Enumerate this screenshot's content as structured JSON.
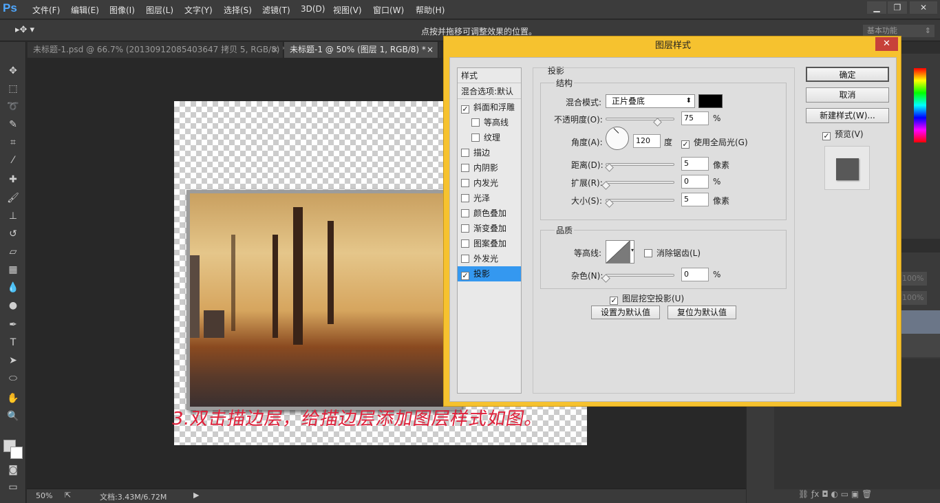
{
  "app": {
    "logo": "Ps"
  },
  "menu": [
    "文件(F)",
    "编辑(E)",
    "图像(I)",
    "图层(L)",
    "文字(Y)",
    "选择(S)",
    "滤镜(T)",
    "3D(D)",
    "视图(V)",
    "窗口(W)",
    "帮助(H)"
  ],
  "options_bar": {
    "hint": "点按并拖移可调整效果的位置。",
    "workspace": "基本功能"
  },
  "tabs": [
    {
      "label": "未标题-1.psd @ 66.7% (20130912085403647 拷贝 5, RGB/8) *"
    },
    {
      "label": "未标题-1 @ 50% (图层 1, RGB/8) *"
    }
  ],
  "caption": "3.双击描边层，给描边层添加图层样式如图。",
  "status": {
    "zoom": "50%",
    "doc": "文档:3.43M/6.72M"
  },
  "right_panel": {
    "opacity1": "100%",
    "opacity2": "100%"
  },
  "dialog": {
    "title": "图层样式",
    "styles_header": "样式",
    "blend_options": "混合选项:默认",
    "items": [
      {
        "label": "斜面和浮雕",
        "checked": "✓"
      },
      {
        "label": "等高线",
        "checked": ""
      },
      {
        "label": "纹理",
        "checked": ""
      },
      {
        "label": "描边",
        "checked": ""
      },
      {
        "label": "内阴影",
        "checked": ""
      },
      {
        "label": "内发光",
        "checked": ""
      },
      {
        "label": "光泽",
        "checked": ""
      },
      {
        "label": "颜色叠加",
        "checked": ""
      },
      {
        "label": "渐变叠加",
        "checked": ""
      },
      {
        "label": "图案叠加",
        "checked": ""
      },
      {
        "label": "外发光",
        "checked": ""
      },
      {
        "label": "投影",
        "checked": "✓"
      }
    ],
    "section_title": "投影",
    "structure": {
      "title": "结构",
      "blend_mode_label": "混合模式:",
      "blend_mode_value": "正片叠底",
      "shadow_color": "#000000",
      "opacity_label": "不透明度(O):",
      "opacity_value": "75",
      "opacity_unit": "%",
      "angle_label": "角度(A):",
      "angle_value": "120",
      "angle_unit": "度",
      "global_light_label": "使用全局光(G)",
      "distance_label": "距离(D):",
      "distance_value": "5",
      "distance_unit": "像素",
      "spread_label": "扩展(R):",
      "spread_value": "0",
      "spread_unit": "%",
      "size_label": "大小(S):",
      "size_value": "5",
      "size_unit": "像素"
    },
    "quality": {
      "title": "品质",
      "contour_label": "等高线:",
      "antialias_label": "消除锯齿(L)",
      "noise_label": "杂色(N):",
      "noise_value": "0",
      "noise_unit": "%"
    },
    "knockout_label": "图层挖空投影(U)",
    "set_default": "设置为默认值",
    "reset_default": "复位为默认值",
    "ok": "确定",
    "cancel": "取消",
    "new_style": "新建样式(W)...",
    "preview_label": "预览(V)"
  },
  "colors": {
    "accent": "#3498f0",
    "dialog_frame": "#f6c22f",
    "caption": "#e0203a"
  }
}
